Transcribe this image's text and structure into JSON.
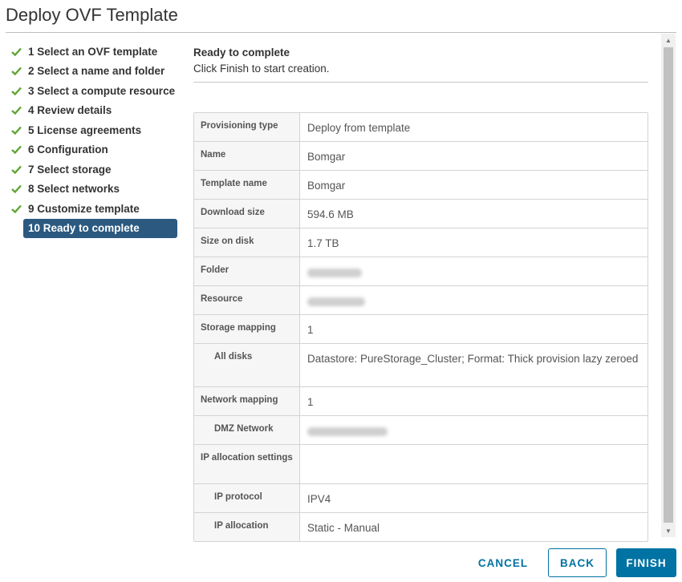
{
  "dialog": {
    "title": "Deploy OVF Template"
  },
  "steps": [
    {
      "label": "1 Select an OVF template",
      "done": true
    },
    {
      "label": "2 Select a name and folder",
      "done": true
    },
    {
      "label": "3 Select a compute resource",
      "done": true
    },
    {
      "label": "4 Review details",
      "done": true
    },
    {
      "label": "5 License agreements",
      "done": true
    },
    {
      "label": "6 Configuration",
      "done": true
    },
    {
      "label": "7 Select storage",
      "done": true
    },
    {
      "label": "8 Select networks",
      "done": true
    },
    {
      "label": "9 Customize template",
      "done": true
    },
    {
      "label": "10 Ready to complete",
      "done": false,
      "active": true
    }
  ],
  "main": {
    "heading": "Ready to complete",
    "subheading": "Click Finish to start creation."
  },
  "summary": [
    {
      "key": "Provisioning type",
      "value": "Deploy from template"
    },
    {
      "key": "Name",
      "value": "Bomgar"
    },
    {
      "key": "Template name",
      "value": "Bomgar"
    },
    {
      "key": "Download size",
      "value": "594.6 MB"
    },
    {
      "key": "Size on disk",
      "value": "1.7 TB"
    },
    {
      "key": "Folder",
      "value": ""
    },
    {
      "key": "Resource",
      "value": ""
    },
    {
      "key": "Storage mapping",
      "value": "1"
    },
    {
      "key": "All disks",
      "value": "Datastore: PureStorage_Cluster; Format: Thick provision lazy zeroed"
    },
    {
      "key": "Network mapping",
      "value": "1"
    },
    {
      "key": "DMZ Network",
      "value": ""
    },
    {
      "key": "IP allocation settings",
      "value": ""
    },
    {
      "key": "IP protocol",
      "value": "IPV4"
    },
    {
      "key": "IP allocation",
      "value": "Static - Manual"
    }
  ],
  "footer": {
    "cancel_label": "CANCEL",
    "back_label": "BACK",
    "finish_label": "FINISH"
  },
  "colors": {
    "check": "#5fa536",
    "active_step_bg": "#2b5980",
    "primary": "#0072a3"
  }
}
